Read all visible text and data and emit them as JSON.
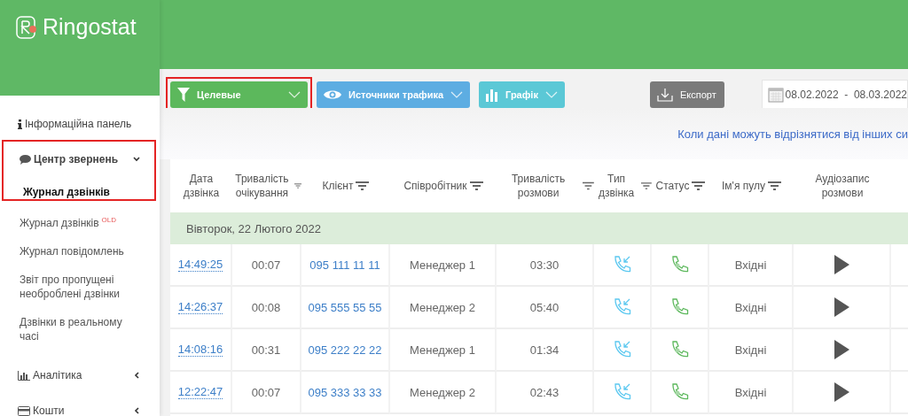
{
  "sidebar": {
    "logo": "Ringostat",
    "items": [
      {
        "kind": "link",
        "label": "Інформаційна панель"
      },
      {
        "kind": "group",
        "label": "Центр звернень",
        "expanded": true,
        "highlighted": true,
        "children": [
          {
            "label": "Журнал дзвінків",
            "selected": true
          },
          {
            "label": "Журнал дзвінків",
            "badge": "OLD",
            "selected": false
          },
          {
            "label": "Журнал повідомлень",
            "selected": false
          },
          {
            "label": "Звіт про пропущені необроблені дзвінки",
            "selected": false
          },
          {
            "label": "Дзвінки в реальному часі",
            "selected": false
          }
        ]
      },
      {
        "kind": "group",
        "label": "Аналітика",
        "expanded": false
      },
      {
        "kind": "group",
        "label": "Кошти",
        "expanded": false
      }
    ]
  },
  "toolbar": {
    "filters": [
      {
        "kind": "filter",
        "label": "Целевые",
        "color": "#5cb85c",
        "highlighted": true
      },
      {
        "kind": "eye",
        "label": "Источники трафика",
        "color": "#5dade2",
        "highlighted": false
      },
      {
        "kind": "chart",
        "label": "Графік",
        "color": "#5bc8d6",
        "highlighted": false
      }
    ],
    "export": "Експорт",
    "date_range": "08.02.2022  -  08.03.2022"
  },
  "notice": "Коли дані можуть відрізнятися від інших си",
  "table": {
    "columns": [
      {
        "label": "Дата дзвінка",
        "filter": false
      },
      {
        "label": "Тривалість очікування",
        "filter": true
      },
      {
        "label": "Клієнт",
        "filter": true
      },
      {
        "label": "Співробітник",
        "filter": true
      },
      {
        "label": "Тривалість розмови",
        "filter": true
      },
      {
        "label": "Тип дзвінка",
        "filter": true
      },
      {
        "label": "Статус",
        "filter": true
      },
      {
        "label": "Ім'я пулу",
        "filter": true
      },
      {
        "label": "Аудіозапис розмови",
        "filter": false
      }
    ],
    "group": "Вівторок, 22 Лютого 2022",
    "rows": [
      {
        "time": "14:49:25",
        "wait": "00:07",
        "client": "095 111 11 11",
        "employee": "Менеджер 1",
        "duration": "03:30",
        "pool": "Вхідні"
      },
      {
        "time": "14:26:37",
        "wait": "00:08",
        "client": "095 555 55 55",
        "employee": "Менеджер 2",
        "duration": "05:40",
        "pool": "Вхідні"
      },
      {
        "time": "14:08:16",
        "wait": "00:31",
        "client": "095 222 22 22",
        "employee": "Менеджер 1",
        "duration": "01:34",
        "pool": "Вхідні"
      },
      {
        "time": "12:22:47",
        "wait": "00:07",
        "client": "095 333 33 33",
        "employee": "Менеджер 2",
        "duration": "02:43",
        "pool": "Вхідні"
      }
    ]
  }
}
